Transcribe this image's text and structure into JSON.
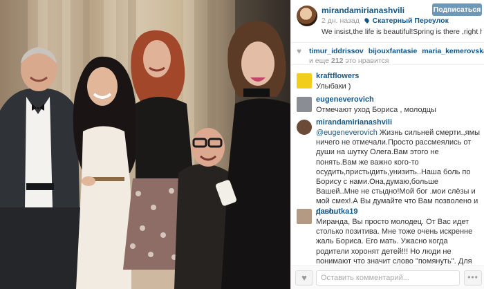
{
  "post": {
    "username": "mirandamirianashvili",
    "follow_label": "Подписаться",
    "time": "2 дн. назад",
    "location": "Скатерный Переулок",
    "caption": "We insist,the life is beautiful!Spring is there ,right here.",
    "avatar_icon": "user-avatar"
  },
  "likes": {
    "likers": [
      "timur_iddrissov",
      "bijouxfantasie",
      "maria_kemerovskaya"
    ],
    "count_prefix": "и еще",
    "count": "212",
    "count_suffix": "это нравится",
    "icon": "heart-icon"
  },
  "comments": [
    {
      "user": "kraftflowers",
      "avatar_color": "#f2cd1a",
      "text": "Улыбаки )"
    },
    {
      "user": "eugeneverovich",
      "avatar_color": "#8a8d93",
      "text": "Отмечают уход Бориса , молодцы"
    },
    {
      "user": "mirandamirianashvili",
      "avatar_color": "#6b4a37",
      "mention": "@eugeneverovich",
      "text": " Жизнь сильней смерти.,ямы ничего не отмечали.Просто рассмеялись от души на шутку Олега.Вам этого не понять.Вам же важно кого-то осудить,пристыдить,унизить..Наша боль по Борису с нами.Она,думаю,больше Вашей..Мне не стыдно!Мой бог .мои слёзы и мой смех!.А Вы думайте что Вам позволено и дано.."
    },
    {
      "user": "dashutka19",
      "avatar_color": "#b59a83",
      "text": "Миранда, Вы просто молодец. От Вас идет столько позитива. Мне тоже очень искренне жаль Бориса. Его мать. Ужасно когда родители хоронят детей!!! Но люди не понимают что значит слово \"помянуть\". Для многих это означает убиваться в"
    }
  ],
  "footer": {
    "comment_placeholder": "Оставить комментарий...",
    "like_icon": "heart-icon",
    "more_label": "•••"
  },
  "colors": {
    "link": "#125688",
    "follow_button": "#6f97b6",
    "muted": "#999999"
  }
}
